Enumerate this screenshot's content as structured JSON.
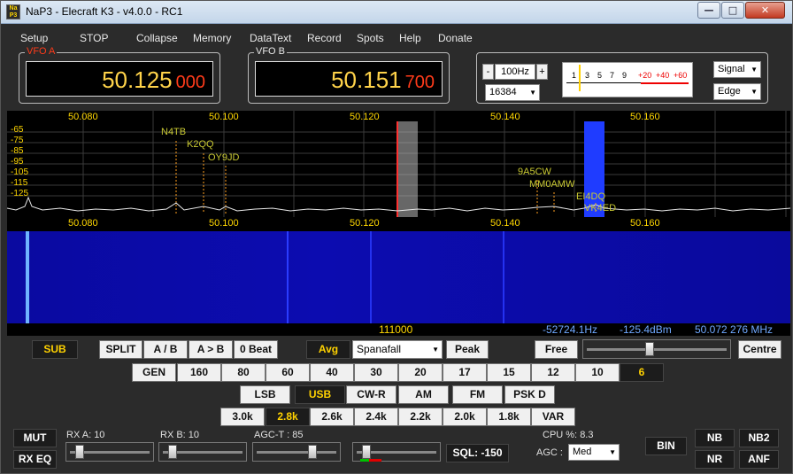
{
  "window": {
    "title": "NaP3 - Elecraft K3 - v4.0.0 - RC1",
    "icon_text": "Na P3"
  },
  "window_buttons": {
    "minimize": "—",
    "maximize": "□",
    "close": "✕"
  },
  "menu": [
    "Setup",
    "STOP",
    "Collapse",
    "Memory",
    "DataText",
    "Record",
    "Spots",
    "Help",
    "Donate"
  ],
  "vfo_a": {
    "label": "VFO A",
    "main": "50.125",
    "sub": "000",
    "label_color": "#ff3b1a"
  },
  "vfo_b": {
    "label": "VFO B",
    "main": "50.151",
    "sub": "700",
    "label_color": "#e8e8e8"
  },
  "span": {
    "minus": "-",
    "plus": "+",
    "value": "100Hz",
    "fft": "16384"
  },
  "meter": {
    "scale": [
      "1",
      "3",
      "5",
      "7",
      "9",
      "+20",
      "+40",
      "+60"
    ]
  },
  "display_select": {
    "mode": "Signal",
    "edge": "Edge"
  },
  "spectrum": {
    "db_scale": [
      "-65",
      "-75",
      "-85",
      "-95",
      "-105",
      "-115",
      "-125"
    ],
    "freq_scale": [
      "50.080",
      "50.100",
      "50.120",
      "50.140",
      "50.160"
    ],
    "spots": [
      "N4TB",
      "K2QQ",
      "OY9JD",
      "9A5CW",
      "MM0AMW",
      "EI4DQ",
      "VK4ED"
    ]
  },
  "status": {
    "center": "111000",
    "offset": "-52724.1Hz",
    "level": "-125.4dBm",
    "freq": "50.072 276 MHz"
  },
  "row1": {
    "sub": "SUB",
    "split": "SPLIT",
    "ab": "A / B",
    "atob": "A > B",
    "zerobeat": "0 Beat",
    "avg": "Avg",
    "display_mode": "Spanafall",
    "peak": "Peak",
    "free": "Free",
    "centre": "Centre"
  },
  "bands": [
    "GEN",
    "160",
    "80",
    "60",
    "40",
    "30",
    "20",
    "17",
    "15",
    "12",
    "10",
    "6"
  ],
  "modes": [
    "LSB",
    "USB",
    "CW-R",
    "AM",
    "FM",
    "PSK D"
  ],
  "filters": [
    "3.0k",
    "2.8k",
    "2.6k",
    "2.4k",
    "2.2k",
    "2.0k",
    "1.8k",
    "VAR"
  ],
  "bottom": {
    "mut": "MUT",
    "rxeq": "RX EQ",
    "rxa_label": "RX A:",
    "rxa_val": "10",
    "rxb_label": "RX B:",
    "rxb_val": "10",
    "agct_label": "AGC-T :",
    "agct_val": "85",
    "sql": "SQL: -150",
    "cpu_label": "CPU %:",
    "cpu_val": "8.3",
    "agc_label": "AGC :",
    "agc_val": "Med",
    "bin": "BIN",
    "nb": "NB",
    "nb2": "NB2",
    "nr": "NR",
    "anf": "ANF"
  },
  "colors": {
    "accent": "#ffd200",
    "spot_label": "#c8c832",
    "freq_label": "#ffd700",
    "status_blue": "#6fa8ff"
  }
}
